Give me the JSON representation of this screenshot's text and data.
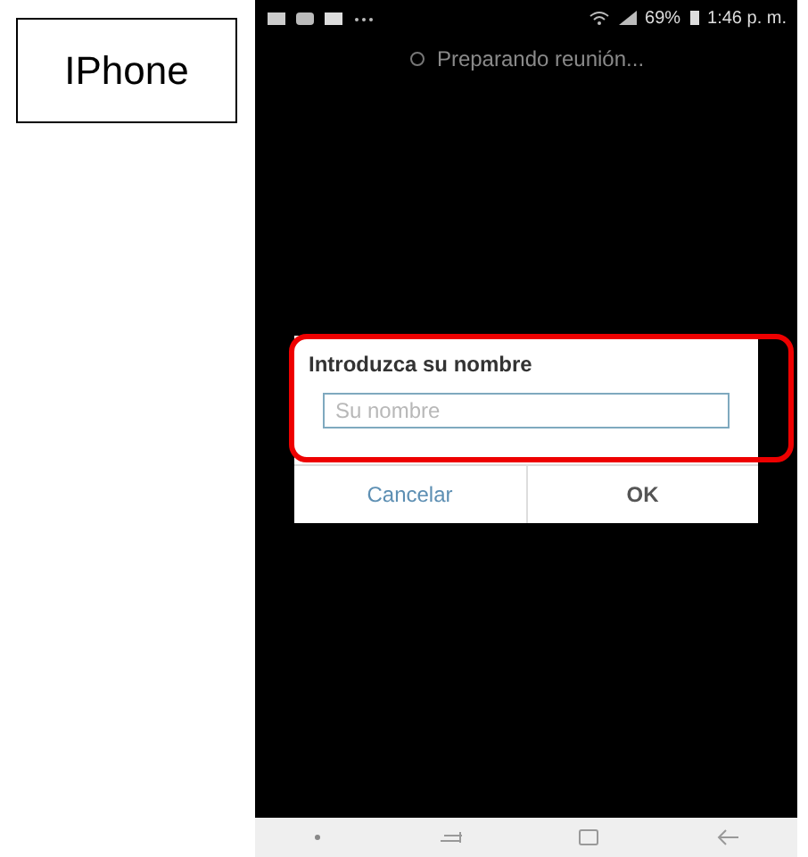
{
  "device_label": "IPhone",
  "status_bar": {
    "battery": "69%",
    "time": "1:46 p. m."
  },
  "header": {
    "text": "Preparando reunión..."
  },
  "dialog": {
    "title": "Introduzca su nombre",
    "input": {
      "placeholder": "Su nombre"
    },
    "buttons": [
      {
        "label": "Cancelar",
        "kind": "cancel"
      },
      {
        "label": "OK",
        "kind": "confirm"
      }
    ]
  }
}
